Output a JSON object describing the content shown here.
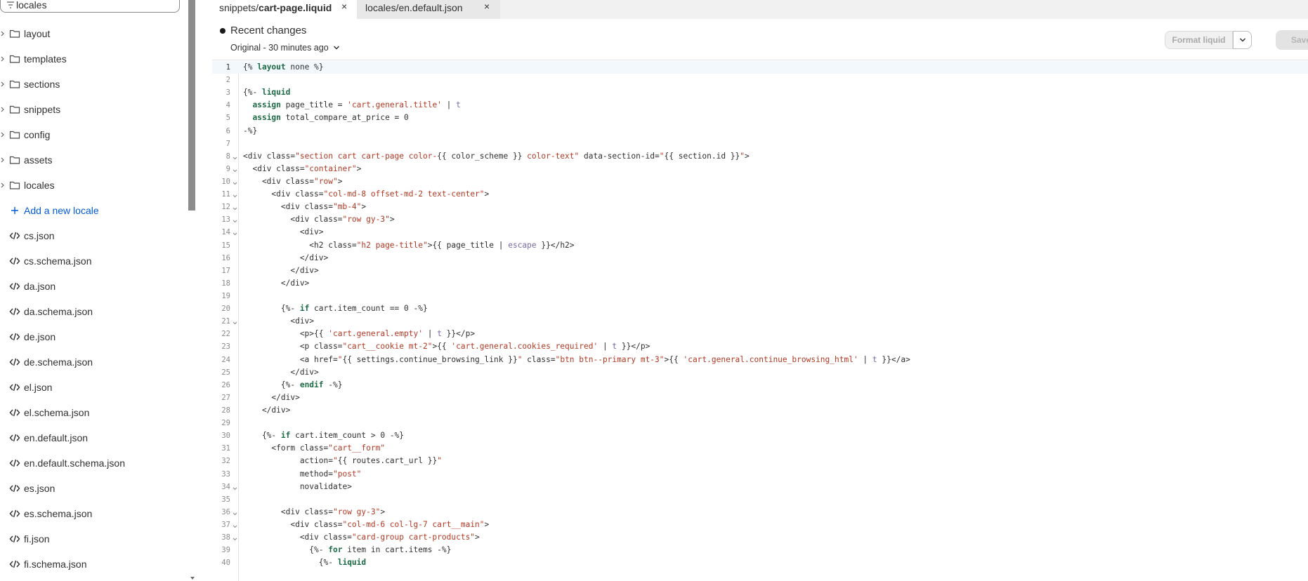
{
  "sidebar": {
    "search_value": "locales",
    "items": [
      {
        "label": "layout",
        "type": "folder"
      },
      {
        "label": "templates",
        "type": "folder"
      },
      {
        "label": "sections",
        "type": "folder"
      },
      {
        "label": "snippets",
        "type": "folder"
      },
      {
        "label": "config",
        "type": "folder"
      },
      {
        "label": "assets",
        "type": "folder"
      },
      {
        "label": "locales",
        "type": "folder"
      },
      {
        "label": "Add a new locale",
        "type": "add"
      },
      {
        "label": "cs.json",
        "type": "file"
      },
      {
        "label": "cs.schema.json",
        "type": "file"
      },
      {
        "label": "da.json",
        "type": "file"
      },
      {
        "label": "da.schema.json",
        "type": "file"
      },
      {
        "label": "de.json",
        "type": "file"
      },
      {
        "label": "de.schema.json",
        "type": "file"
      },
      {
        "label": "el.json",
        "type": "file"
      },
      {
        "label": "el.schema.json",
        "type": "file"
      },
      {
        "label": "en.default.json",
        "type": "file"
      },
      {
        "label": "en.default.schema.json",
        "type": "file"
      },
      {
        "label": "es.json",
        "type": "file"
      },
      {
        "label": "es.schema.json",
        "type": "file"
      },
      {
        "label": "fi.json",
        "type": "file"
      },
      {
        "label": "fi.schema.json",
        "type": "file"
      }
    ]
  },
  "tabs": [
    {
      "prefix": "snippets/",
      "name": "cart-page.liquid",
      "close": "×"
    },
    {
      "prefix": "",
      "name": "locales/en.default.json",
      "close": "×"
    }
  ],
  "header": {
    "recent_title": "Recent changes",
    "recent_sub": "Original - 30 minutes ago",
    "format_label": "Format liquid",
    "save_label": "Save"
  },
  "colors": {
    "keyword": "#1d6b45",
    "string": "#b33a24",
    "filter": "#7d6aa7",
    "link": "#005bd3"
  },
  "code": [
    {
      "n": "1",
      "fold": false,
      "active": true,
      "tokens": [
        [
          "p",
          "{% "
        ],
        [
          "kw",
          "layout"
        ],
        [
          "p",
          " none %}"
        ]
      ]
    },
    {
      "n": "2",
      "fold": false,
      "tokens": []
    },
    {
      "n": "3",
      "fold": false,
      "tokens": [
        [
          "p",
          "{%- "
        ],
        [
          "kw",
          "liquid"
        ]
      ]
    },
    {
      "n": "4",
      "fold": false,
      "tokens": [
        [
          "p",
          "  "
        ],
        [
          "kw",
          "assign"
        ],
        [
          "p",
          " page_title = "
        ],
        [
          "str",
          "'cart.general.title'"
        ],
        [
          "p",
          " | "
        ],
        [
          "fil",
          "t"
        ]
      ]
    },
    {
      "n": "5",
      "fold": false,
      "tokens": [
        [
          "p",
          "  "
        ],
        [
          "kw",
          "assign"
        ],
        [
          "p",
          " total_compare_at_price = 0"
        ]
      ]
    },
    {
      "n": "6",
      "fold": false,
      "tokens": [
        [
          "p",
          "-%}"
        ]
      ]
    },
    {
      "n": "7",
      "fold": false,
      "tokens": []
    },
    {
      "n": "8",
      "fold": true,
      "tokens": [
        [
          "p",
          "<div class="
        ],
        [
          "str",
          "\"section cart cart-page color-"
        ],
        [
          "p",
          "{{ color_scheme }}"
        ],
        [
          "str",
          " color-text\""
        ],
        [
          "p",
          " data-section-id="
        ],
        [
          "str",
          "\""
        ],
        [
          "p",
          "{{ section.id }}"
        ],
        [
          "str",
          "\""
        ],
        [
          "p",
          ">"
        ]
      ]
    },
    {
      "n": "9",
      "fold": true,
      "tokens": [
        [
          "p",
          "  <div class="
        ],
        [
          "str",
          "\"container\""
        ],
        [
          "p",
          ">"
        ]
      ]
    },
    {
      "n": "10",
      "fold": true,
      "tokens": [
        [
          "p",
          "    <div class="
        ],
        [
          "str",
          "\"row\""
        ],
        [
          "p",
          ">"
        ]
      ]
    },
    {
      "n": "11",
      "fold": true,
      "tokens": [
        [
          "p",
          "      <div class="
        ],
        [
          "str",
          "\"col-md-8 offset-md-2 text-center\""
        ],
        [
          "p",
          ">"
        ]
      ]
    },
    {
      "n": "12",
      "fold": true,
      "tokens": [
        [
          "p",
          "        <div class="
        ],
        [
          "str",
          "\"mb-4\""
        ],
        [
          "p",
          ">"
        ]
      ]
    },
    {
      "n": "13",
      "fold": true,
      "tokens": [
        [
          "p",
          "          <div class="
        ],
        [
          "str",
          "\"row gy-3\""
        ],
        [
          "p",
          ">"
        ]
      ]
    },
    {
      "n": "14",
      "fold": true,
      "tokens": [
        [
          "p",
          "            <div>"
        ]
      ]
    },
    {
      "n": "15",
      "fold": false,
      "tokens": [
        [
          "p",
          "              <h2 class="
        ],
        [
          "str",
          "\"h2 page-title\""
        ],
        [
          "p",
          ">{{ page_title | "
        ],
        [
          "fil",
          "escape"
        ],
        [
          "p",
          " }}</h2>"
        ]
      ]
    },
    {
      "n": "16",
      "fold": false,
      "tokens": [
        [
          "p",
          "            </div>"
        ]
      ]
    },
    {
      "n": "17",
      "fold": false,
      "tokens": [
        [
          "p",
          "          </div>"
        ]
      ]
    },
    {
      "n": "18",
      "fold": false,
      "tokens": [
        [
          "p",
          "        </div>"
        ]
      ]
    },
    {
      "n": "19",
      "fold": false,
      "tokens": []
    },
    {
      "n": "20",
      "fold": false,
      "tokens": [
        [
          "p",
          "        {%- "
        ],
        [
          "kw",
          "if"
        ],
        [
          "p",
          " cart.item_count == 0 -%}"
        ]
      ]
    },
    {
      "n": "21",
      "fold": true,
      "tokens": [
        [
          "p",
          "          <div>"
        ]
      ]
    },
    {
      "n": "22",
      "fold": false,
      "tokens": [
        [
          "p",
          "            <p>{{ "
        ],
        [
          "str",
          "'cart.general.empty'"
        ],
        [
          "p",
          " | "
        ],
        [
          "fil",
          "t"
        ],
        [
          "p",
          " }}</p>"
        ]
      ]
    },
    {
      "n": "23",
      "fold": false,
      "tokens": [
        [
          "p",
          "            <p class="
        ],
        [
          "str",
          "\"cart__cookie mt-2\""
        ],
        [
          "p",
          ">{{ "
        ],
        [
          "str",
          "'cart.general.cookies_required'"
        ],
        [
          "p",
          " | "
        ],
        [
          "fil",
          "t"
        ],
        [
          "p",
          " }}</p>"
        ]
      ]
    },
    {
      "n": "24",
      "fold": false,
      "tokens": [
        [
          "p",
          "            <a href="
        ],
        [
          "str",
          "\""
        ],
        [
          "p",
          "{{ settings.continue_browsing_link }}"
        ],
        [
          "str",
          "\""
        ],
        [
          "p",
          " class="
        ],
        [
          "str",
          "\"btn btn--primary mt-3\""
        ],
        [
          "p",
          ">{{ "
        ],
        [
          "str",
          "'cart.general.continue_browsing_html'"
        ],
        [
          "p",
          " | "
        ],
        [
          "fil",
          "t"
        ],
        [
          "p",
          " }}</a>"
        ]
      ]
    },
    {
      "n": "25",
      "fold": false,
      "tokens": [
        [
          "p",
          "          </div>"
        ]
      ]
    },
    {
      "n": "26",
      "fold": false,
      "tokens": [
        [
          "p",
          "        {%- "
        ],
        [
          "kw",
          "endif"
        ],
        [
          "p",
          " -%}"
        ]
      ]
    },
    {
      "n": "27",
      "fold": false,
      "tokens": [
        [
          "p",
          "      </div>"
        ]
      ]
    },
    {
      "n": "28",
      "fold": false,
      "tokens": [
        [
          "p",
          "    </div>"
        ]
      ]
    },
    {
      "n": "29",
      "fold": false,
      "tokens": []
    },
    {
      "n": "30",
      "fold": false,
      "tokens": [
        [
          "p",
          "    {%- "
        ],
        [
          "kw",
          "if"
        ],
        [
          "p",
          " cart.item_count > 0 -%}"
        ]
      ]
    },
    {
      "n": "31",
      "fold": false,
      "tokens": [
        [
          "p",
          "      <form class="
        ],
        [
          "str",
          "\"cart__form\""
        ]
      ]
    },
    {
      "n": "32",
      "fold": false,
      "tokens": [
        [
          "p",
          "            action="
        ],
        [
          "str",
          "\""
        ],
        [
          "p",
          "{{ routes.cart_url }}"
        ],
        [
          "str",
          "\""
        ]
      ]
    },
    {
      "n": "33",
      "fold": false,
      "tokens": [
        [
          "p",
          "            method="
        ],
        [
          "str",
          "\"post\""
        ]
      ]
    },
    {
      "n": "34",
      "fold": true,
      "tokens": [
        [
          "p",
          "            novalidate>"
        ]
      ]
    },
    {
      "n": "35",
      "fold": false,
      "tokens": []
    },
    {
      "n": "36",
      "fold": true,
      "tokens": [
        [
          "p",
          "        <div class="
        ],
        [
          "str",
          "\"row gy-3\""
        ],
        [
          "p",
          ">"
        ]
      ]
    },
    {
      "n": "37",
      "fold": true,
      "tokens": [
        [
          "p",
          "          <div class="
        ],
        [
          "str",
          "\"col-md-6 col-lg-7 cart__main\""
        ],
        [
          "p",
          ">"
        ]
      ]
    },
    {
      "n": "38",
      "fold": true,
      "tokens": [
        [
          "p",
          "            <div class="
        ],
        [
          "str",
          "\"card-group cart-products\""
        ],
        [
          "p",
          ">"
        ]
      ]
    },
    {
      "n": "39",
      "fold": false,
      "tokens": [
        [
          "p",
          "              {%- "
        ],
        [
          "kw",
          "for"
        ],
        [
          "p",
          " item in cart.items -%}"
        ]
      ]
    },
    {
      "n": "40",
      "fold": false,
      "tokens": [
        [
          "p",
          "                {%- "
        ],
        [
          "kw",
          "liquid"
        ]
      ]
    }
  ]
}
